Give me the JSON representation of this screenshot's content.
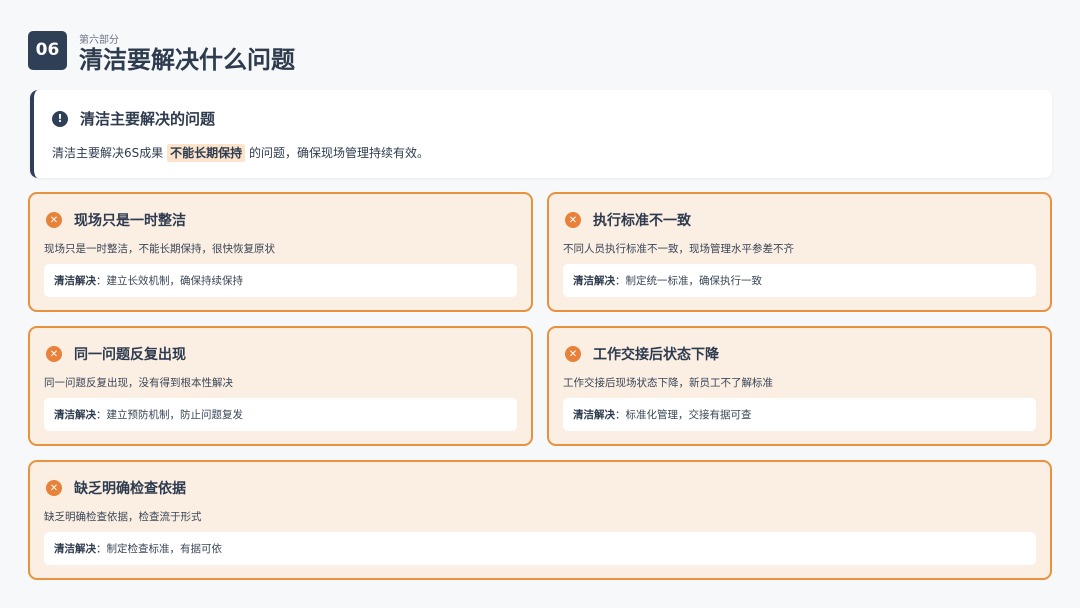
{
  "header": {
    "number": "06",
    "subtitle": "第六部分",
    "title": "清洁要解决什么问题"
  },
  "intro": {
    "icon": "exclamation-icon",
    "title": "清洁主要解决的问题",
    "text_before": "清洁主要解决6S成果",
    "highlight": "不能长期保持",
    "text_after": "的问题，确保现场管理持续有效。"
  },
  "colors": {
    "accent": "#e8913f",
    "card_bg": "#fbeee3",
    "dark": "#2f3f55"
  },
  "cards": [
    {
      "icon": "close-circle-icon",
      "title": "现场只是一时整洁",
      "desc": "现场只是一时整洁，不能长期保持，很快恢复原状",
      "solution_label": "清洁解决",
      "solution": "：建立长效机制，确保持续保持"
    },
    {
      "icon": "close-circle-icon",
      "title": "执行标准不一致",
      "desc": "不同人员执行标准不一致，现场管理水平参差不齐",
      "solution_label": "清洁解决",
      "solution": "：制定统一标准，确保执行一致"
    },
    {
      "icon": "close-circle-icon",
      "title": "同一问题反复出现",
      "desc": "同一问题反复出现，没有得到根本性解决",
      "solution_label": "清洁解决",
      "solution": "：建立预防机制，防止问题复发"
    },
    {
      "icon": "close-circle-icon",
      "title": "工作交接后状态下降",
      "desc": "工作交接后现场状态下降，新员工不了解标准",
      "solution_label": "清洁解决",
      "solution": "：标准化管理，交接有据可查"
    },
    {
      "icon": "close-circle-icon",
      "title": "缺乏明确检查依据",
      "desc": "缺乏明确检查依据，检查流于形式",
      "solution_label": "清洁解决",
      "solution": "：制定检查标准，有据可依"
    }
  ]
}
